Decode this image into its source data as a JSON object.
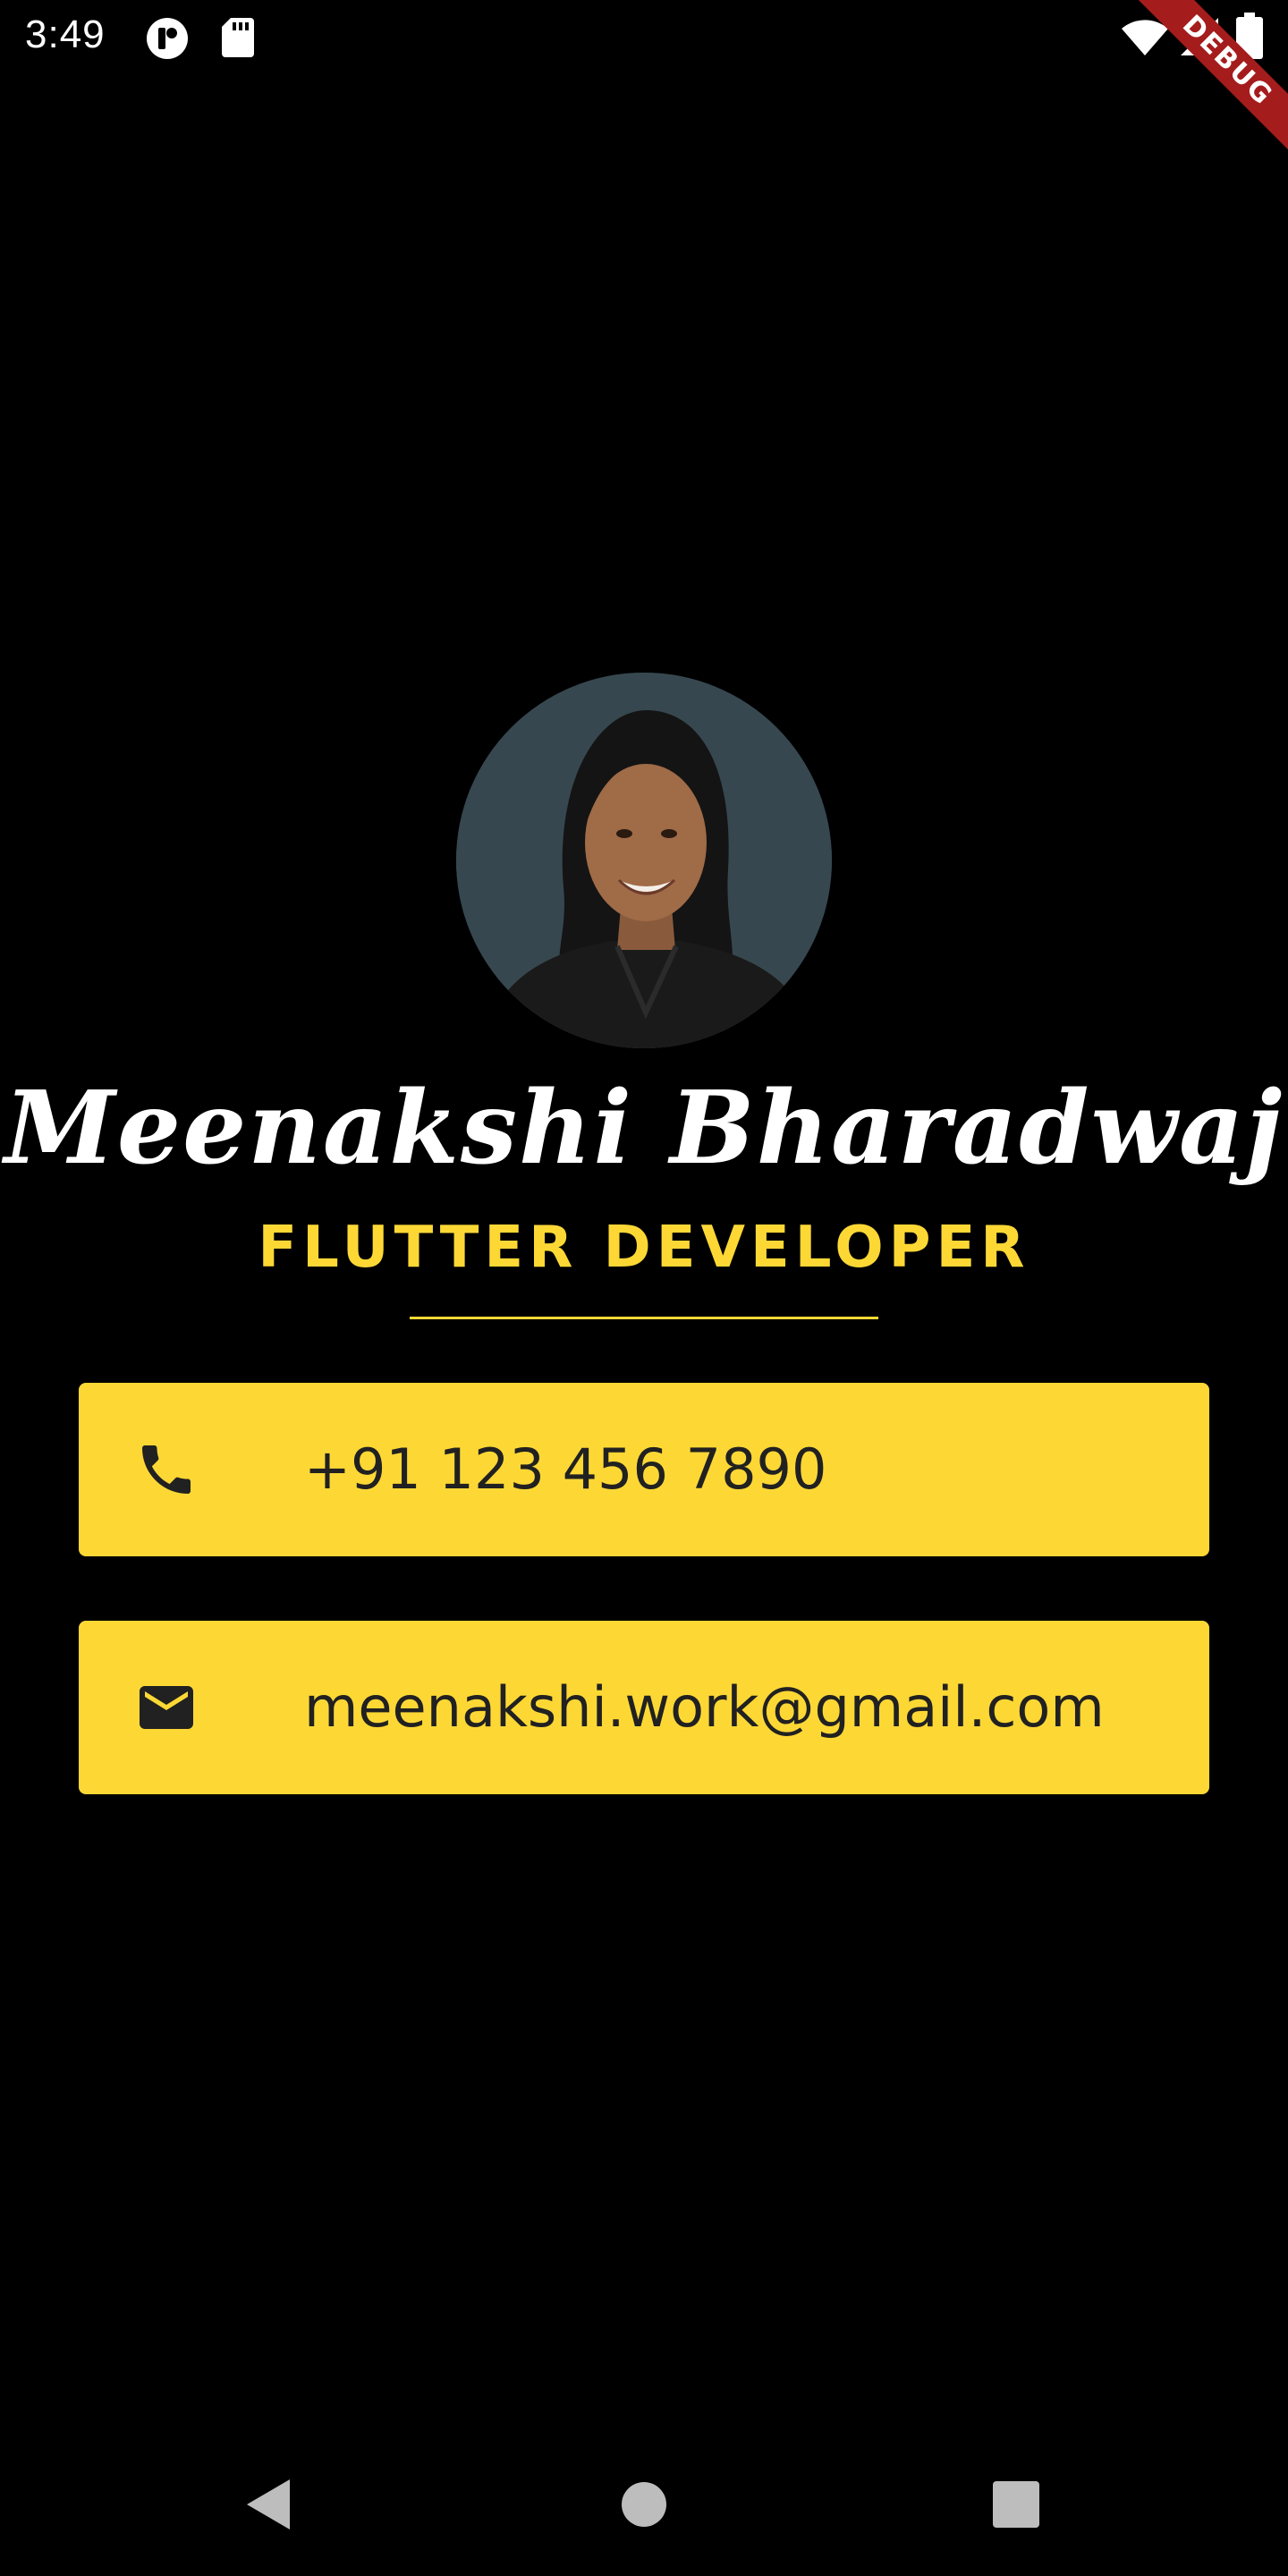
{
  "status_bar": {
    "time": "3:49",
    "icons": [
      "notification-app-icon",
      "sd-card-icon",
      "wifi-icon",
      "cellular-signal-icon",
      "battery-icon"
    ]
  },
  "debug_banner": {
    "label": "DEBUG",
    "color": "#a51c1c"
  },
  "profile": {
    "avatar": "profile-photo",
    "name": "Meenakshi Bharadwaj",
    "role": "FLUTTER DEVELOPER"
  },
  "contacts": {
    "phone": {
      "icon": "phone-icon",
      "value": "+91 123 456 7890"
    },
    "email": {
      "icon": "mail-icon",
      "value": "meenakshi.work@gmail.com"
    }
  },
  "navigation": {
    "icons": [
      "back-icon",
      "home-icon",
      "recents-icon"
    ]
  },
  "colors": {
    "background": "#000000",
    "accent": "#fdd835",
    "card_text": "#212121",
    "name_text": "#ffffff"
  }
}
